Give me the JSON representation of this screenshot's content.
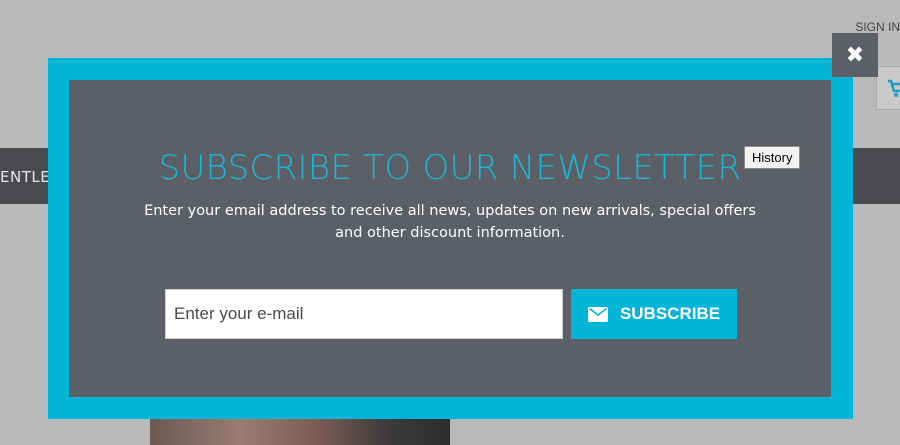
{
  "background": {
    "sign_in_label": "SIGN IN",
    "nav_text": "ENTLE",
    "cart_icon": "cart-icon"
  },
  "modal": {
    "title": "SUBSCRIBE TO OUR NEWSLETTER",
    "description": "Enter your email address to receive all news, updates on new arrivals, special offers and other discount information.",
    "email_placeholder": "Enter your e-mail",
    "email_value": "",
    "subscribe_label": "SUBSCRIBE",
    "subscribe_icon": "envelope-icon",
    "close_icon": "close-icon",
    "close_glyph": "✖",
    "accent_color": "#00b5d6",
    "panel_color": "#5c5f66"
  },
  "tooltip": {
    "text": "History"
  }
}
